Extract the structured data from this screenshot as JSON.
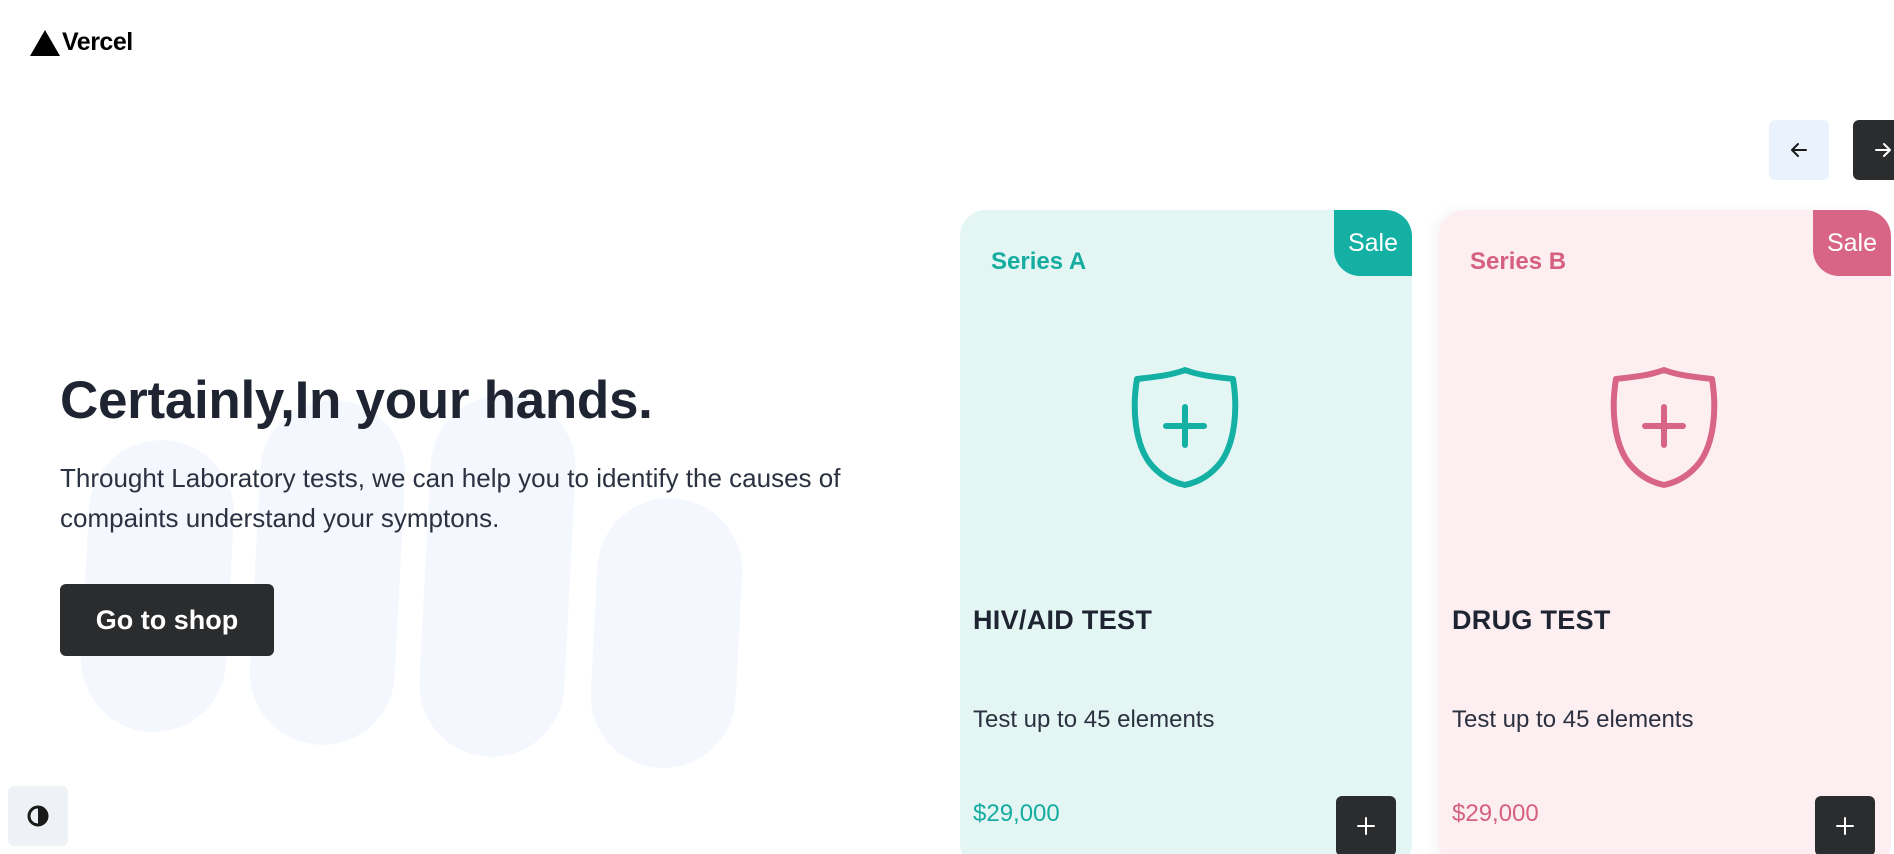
{
  "header": {
    "logo_text": "Vercel"
  },
  "hero": {
    "title": "Certainly,In your hands.",
    "description": "Throught Laboratory tests, we can help you to identify the causes of compaints understand your symptons.",
    "cta_label": "Go to shop"
  },
  "carousel": {
    "prev_icon": "arrow-left-icon",
    "next_icon": "arrow-right-icon",
    "cards": [
      {
        "badge": "Sale",
        "series": "Series A",
        "title": "HIV/AID TEST",
        "subtitle": "Test up to 45 elements",
        "price": "$29,000",
        "accent": "#13b0a3",
        "background": "#e4f6f4"
      },
      {
        "badge": "Sale",
        "series": "Series B",
        "title": "DRUG TEST",
        "subtitle": "Test up to 45 elements",
        "price": "$29,000",
        "accent": "#d86585",
        "background": "#fdeff1"
      }
    ]
  },
  "theme_toggle_icon": "contrast-icon"
}
